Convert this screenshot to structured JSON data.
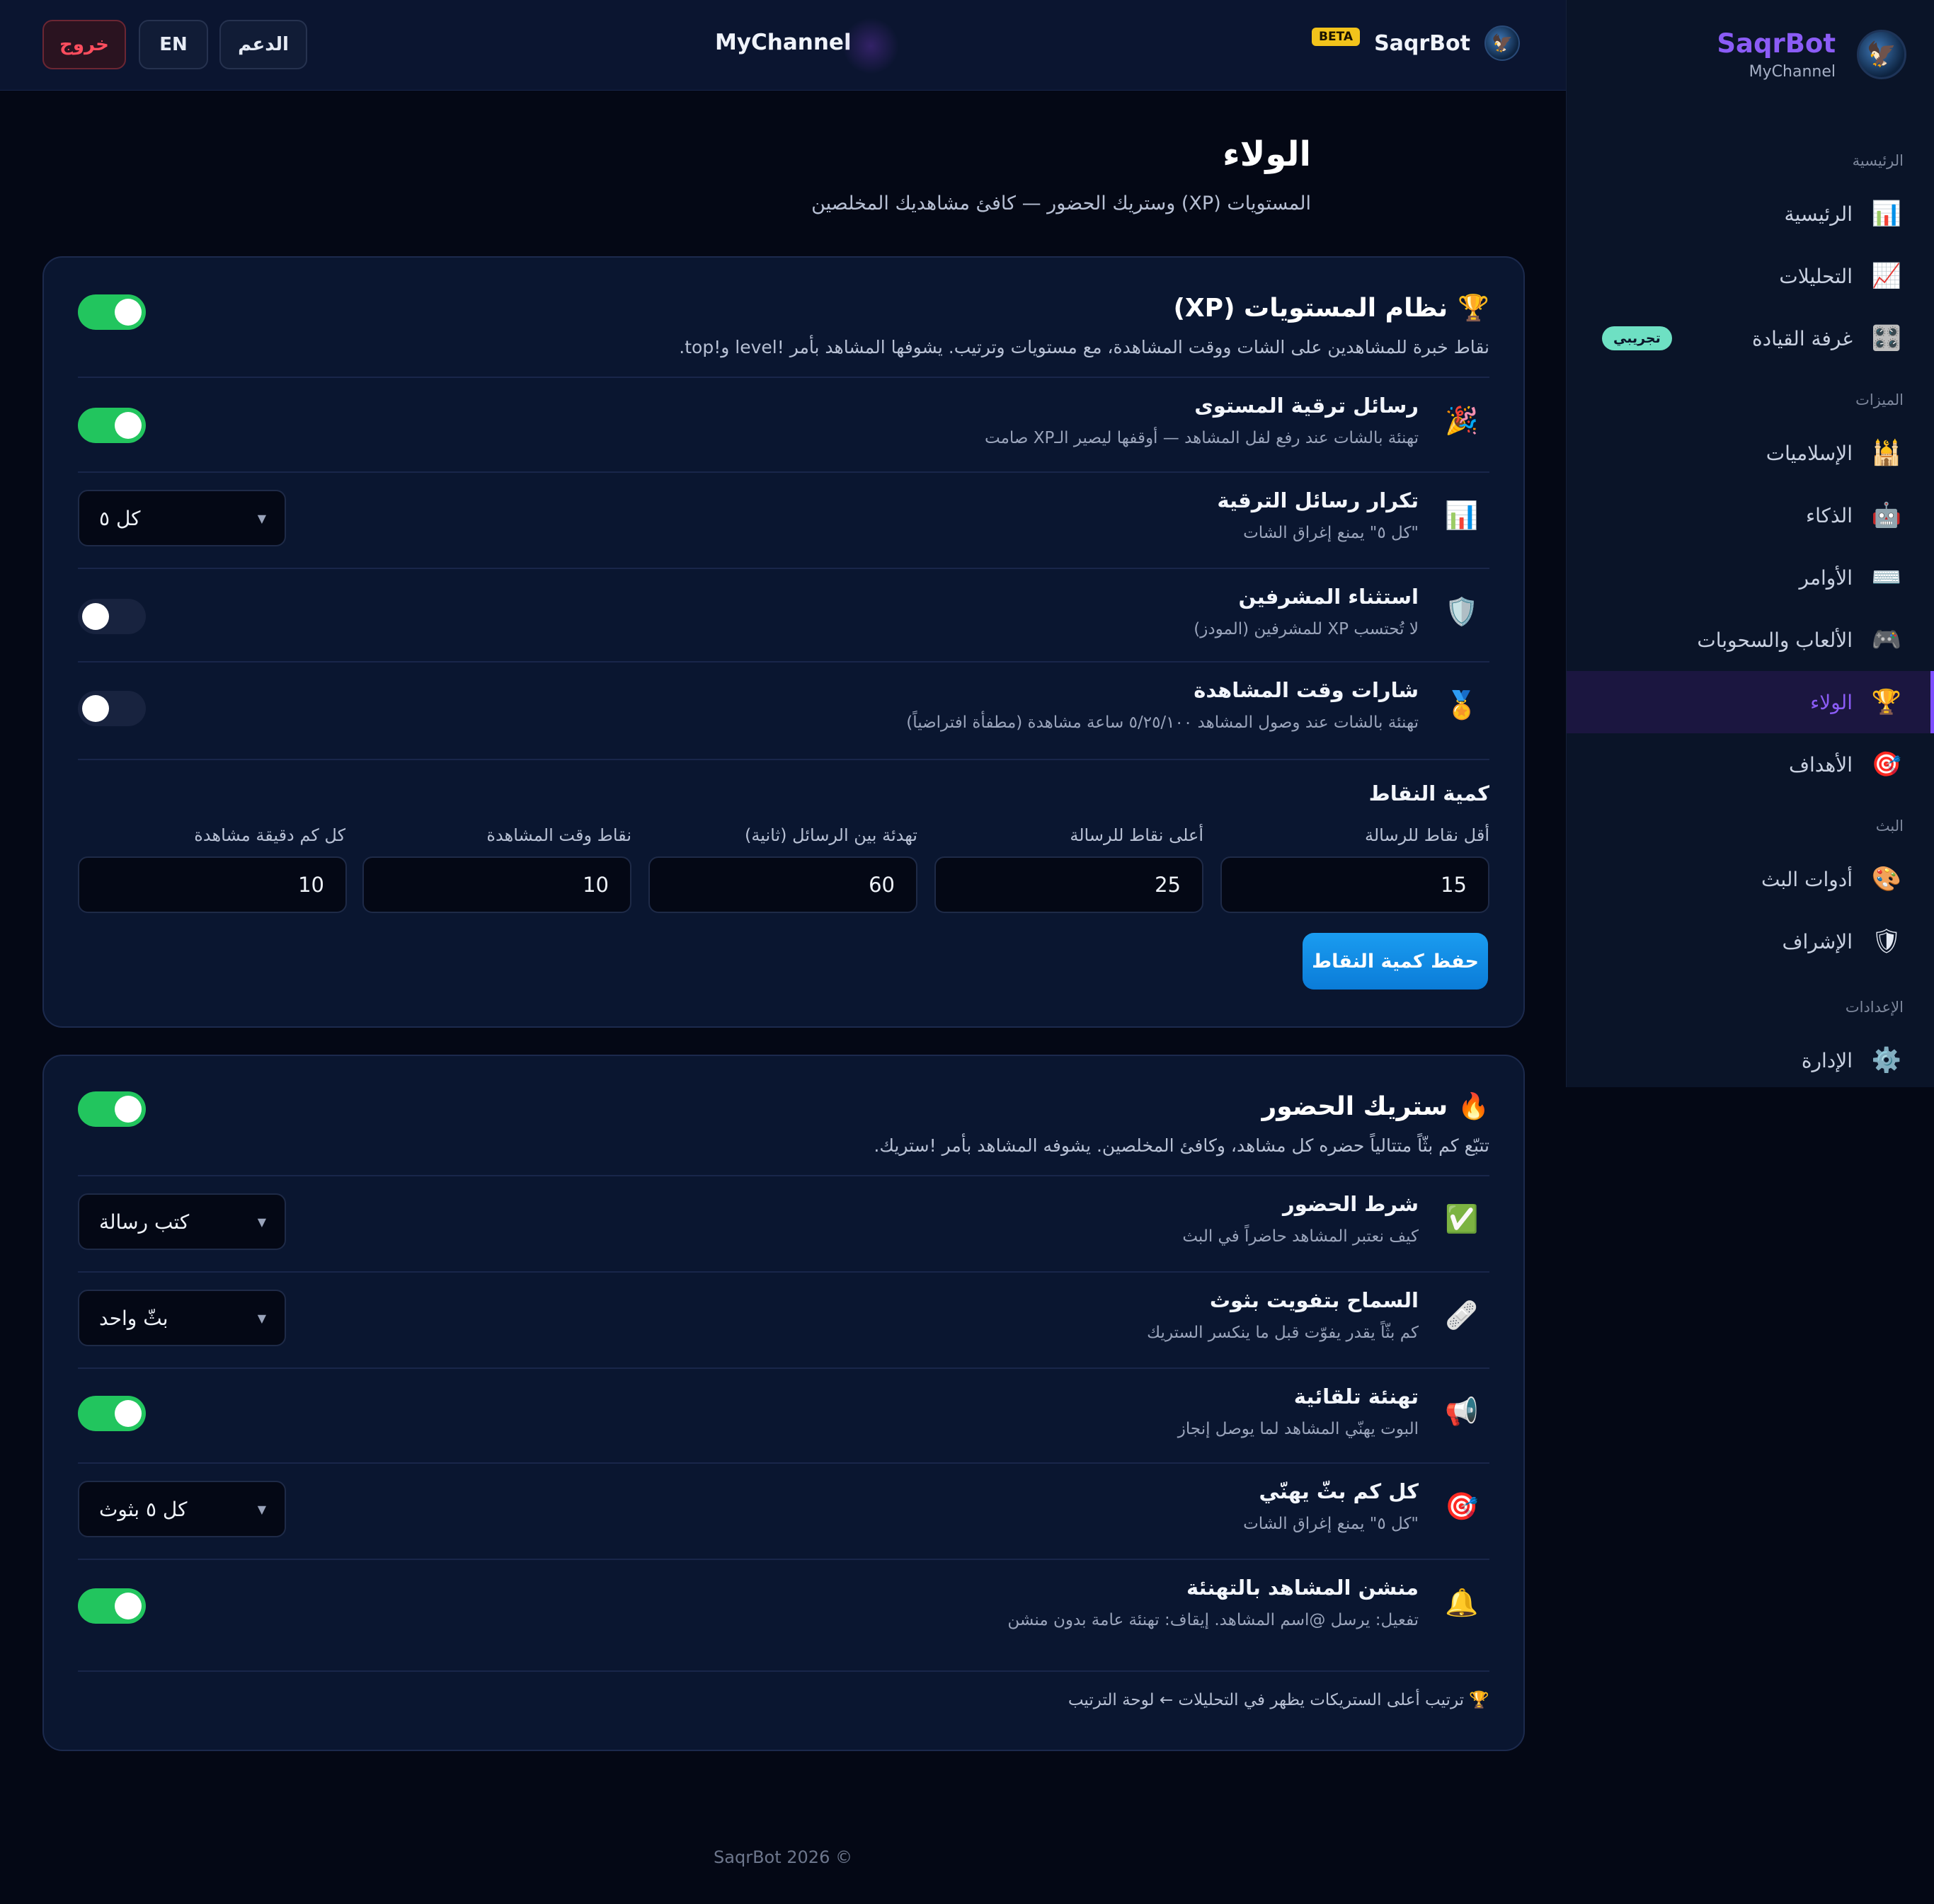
{
  "sidebar": {
    "brand": "SaqrBot",
    "channel": "MyChannel",
    "logo_icon": "falcon-logo",
    "sections": {
      "main": "الرئيسية",
      "features": "الميزات",
      "stream": "البث",
      "settings": "الإعدادات"
    },
    "items": [
      {
        "label": "الرئيسية",
        "icon": "📊"
      },
      {
        "label": "التحليلات",
        "icon": "📈"
      },
      {
        "label": "غرفة القيادة",
        "icon": "🎛️",
        "badge": "تجريبي"
      },
      {
        "label": "الإسلاميات",
        "icon": "🕌"
      },
      {
        "label": "الذكاء",
        "icon": "🤖"
      },
      {
        "label": "الأوامر",
        "icon": "⌨️"
      },
      {
        "label": "الألعاب والسحوبات",
        "icon": "🎮"
      },
      {
        "label": "الولاء",
        "icon": "🏆",
        "active": true
      },
      {
        "label": "الأهداف",
        "icon": "🎯"
      },
      {
        "label": "أدوات البث",
        "icon": "🎨"
      },
      {
        "label": "الإشراف",
        "icon": "🛡"
      },
      {
        "label": "الإدارة",
        "icon": "⚙️"
      }
    ]
  },
  "topbar": {
    "logout": "خروج",
    "lang": "EN",
    "support": "الدعم",
    "channel": "MyChannel",
    "brand": "SaqrBot",
    "beta": "BETA"
  },
  "page": {
    "title": "الولاء",
    "subtitle": "المستويات (XP) وستريك الحضور — كافئ مشاهديك المخلصين"
  },
  "xp_card": {
    "icon": "🏆",
    "title": "نظام المستويات (XP)",
    "description": "نقاط خبرة للمشاهدين على الشات ووقت المشاهدة، مع مستويات وترتيب. يشوفها المشاهد بأمر !level و!top.",
    "enabled": true,
    "rows": [
      {
        "icon": "🎉",
        "title": "رسائل ترقية المستوى",
        "desc": "تهنئة بالشات عند رفع لفل المشاهد — أوقفها ليصير الـXP صامت",
        "control": "toggle",
        "on": true
      },
      {
        "icon": "📊",
        "title": "تكرار رسائل الترقية",
        "desc": "\"كل ٥\" يمنع إغراق الشات",
        "control": "select",
        "value": "كل ٥"
      },
      {
        "icon": "🛡️",
        "title": "استثناء المشرفين",
        "desc": "لا تُحتسب XP للمشرفين (المودز)",
        "control": "toggle",
        "on": false
      },
      {
        "icon": "🏅",
        "title": "شارات وقت المشاهدة",
        "desc": "تهنئة بالشات عند وصول المشاهد ٥/٢٥/١٠٠ ساعة مشاهدة (مطفأة افتراضياً)",
        "control": "toggle",
        "on": false
      }
    ],
    "points": {
      "title": "كمية النقاط",
      "fields": [
        {
          "label": "أقل نقاط للرسالة",
          "value": "15"
        },
        {
          "label": "أعلى نقاط للرسالة",
          "value": "25"
        },
        {
          "label": "تهدئة بين الرسائل (ثانية)",
          "value": "60"
        },
        {
          "label": "نقاط وقت المشاهدة",
          "value": "10"
        },
        {
          "label": "كل كم دقيقة مشاهدة",
          "value": "10"
        }
      ],
      "save": "حفظ كمية النقاط"
    }
  },
  "streak_card": {
    "icon": "🔥",
    "title": "ستريك الحضور",
    "description": "تتبّع كم بثّاً متتالياً حضره كل مشاهد، وكافئ المخلصين. يشوفه المشاهد بأمر !ستريك.",
    "enabled": true,
    "rows": [
      {
        "icon": "✅",
        "title": "شرط الحضور",
        "desc": "كيف نعتبر المشاهد حاضراً في البث",
        "control": "select",
        "value": "كتب رسالة"
      },
      {
        "icon": "🩹",
        "title": "السماح بتفويت بثوث",
        "desc": "كم بثّاً يقدر يفوّت قبل ما ينكسر الستريك",
        "control": "select",
        "value": "بثّ واحد"
      },
      {
        "icon": "📢",
        "title": "تهنئة تلقائية",
        "desc": "البوت يهنّي المشاهد لما يوصل إنجاز",
        "control": "toggle",
        "on": true
      },
      {
        "icon": "🎯",
        "title": "كل كم بثّ يهنّي",
        "desc": "\"كل ٥\" يمنع إغراق الشات",
        "control": "select",
        "value": "كل ٥ بثوث"
      },
      {
        "icon": "🔔",
        "title": "منشن المشاهد بالتهنئة",
        "desc": "تفعيل: يرسل @اسم المشاهد. إيقاف: تهنئة عامة بدون منشن",
        "control": "toggle",
        "on": true
      }
    ],
    "footnote": "🏆 ترتيب أعلى الستريكات يظهر في التحليلات ← لوحة الترتيب"
  },
  "footer": "SaqrBot 2026 ©"
}
